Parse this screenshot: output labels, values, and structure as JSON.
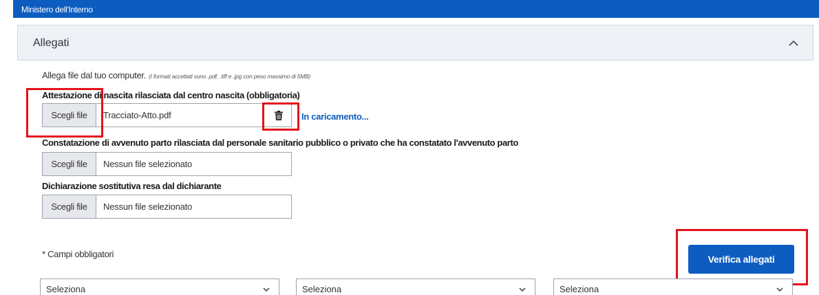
{
  "header": {
    "title": "Ministero dell'Interno"
  },
  "accordion": {
    "title": "Allegati"
  },
  "intro": {
    "text": "Allega file dal tuo computer.",
    "note": "(I formati accettati sono .pdf, .tiff e .jpg con peso massimo di 5MB)"
  },
  "fields": [
    {
      "label": "Attestazione di nascita rilasciata dal centro nascita (obbligatoria)",
      "button": "Scegli file",
      "value": "Tracciato-Atto.pdf",
      "status": "In caricamento..."
    },
    {
      "label": "Constatazione di avvenuto parto rilasciata dal personale sanitario pubblico o privato che ha constatato l'avvenuto parto",
      "button": "Scegli file",
      "value": "Nessun file selezionato"
    },
    {
      "label": "Dichiarazione sostitutiva resa dal dichiarante",
      "button": "Scegli file",
      "value": "Nessun file selezionato"
    }
  ],
  "required_note": "* Campi obbligatori",
  "verify_button": "Verifica allegati",
  "selects": [
    {
      "value": "Seleziona"
    },
    {
      "value": "Seleziona"
    },
    {
      "value": "Seleziona"
    }
  ],
  "colors": {
    "primary": "#0d5dc1",
    "highlight": "#e3121a"
  },
  "icons": {
    "trash": "trash-icon",
    "chevron_up": "chevron-up-icon",
    "chevron_down": "chevron-down-icon"
  }
}
